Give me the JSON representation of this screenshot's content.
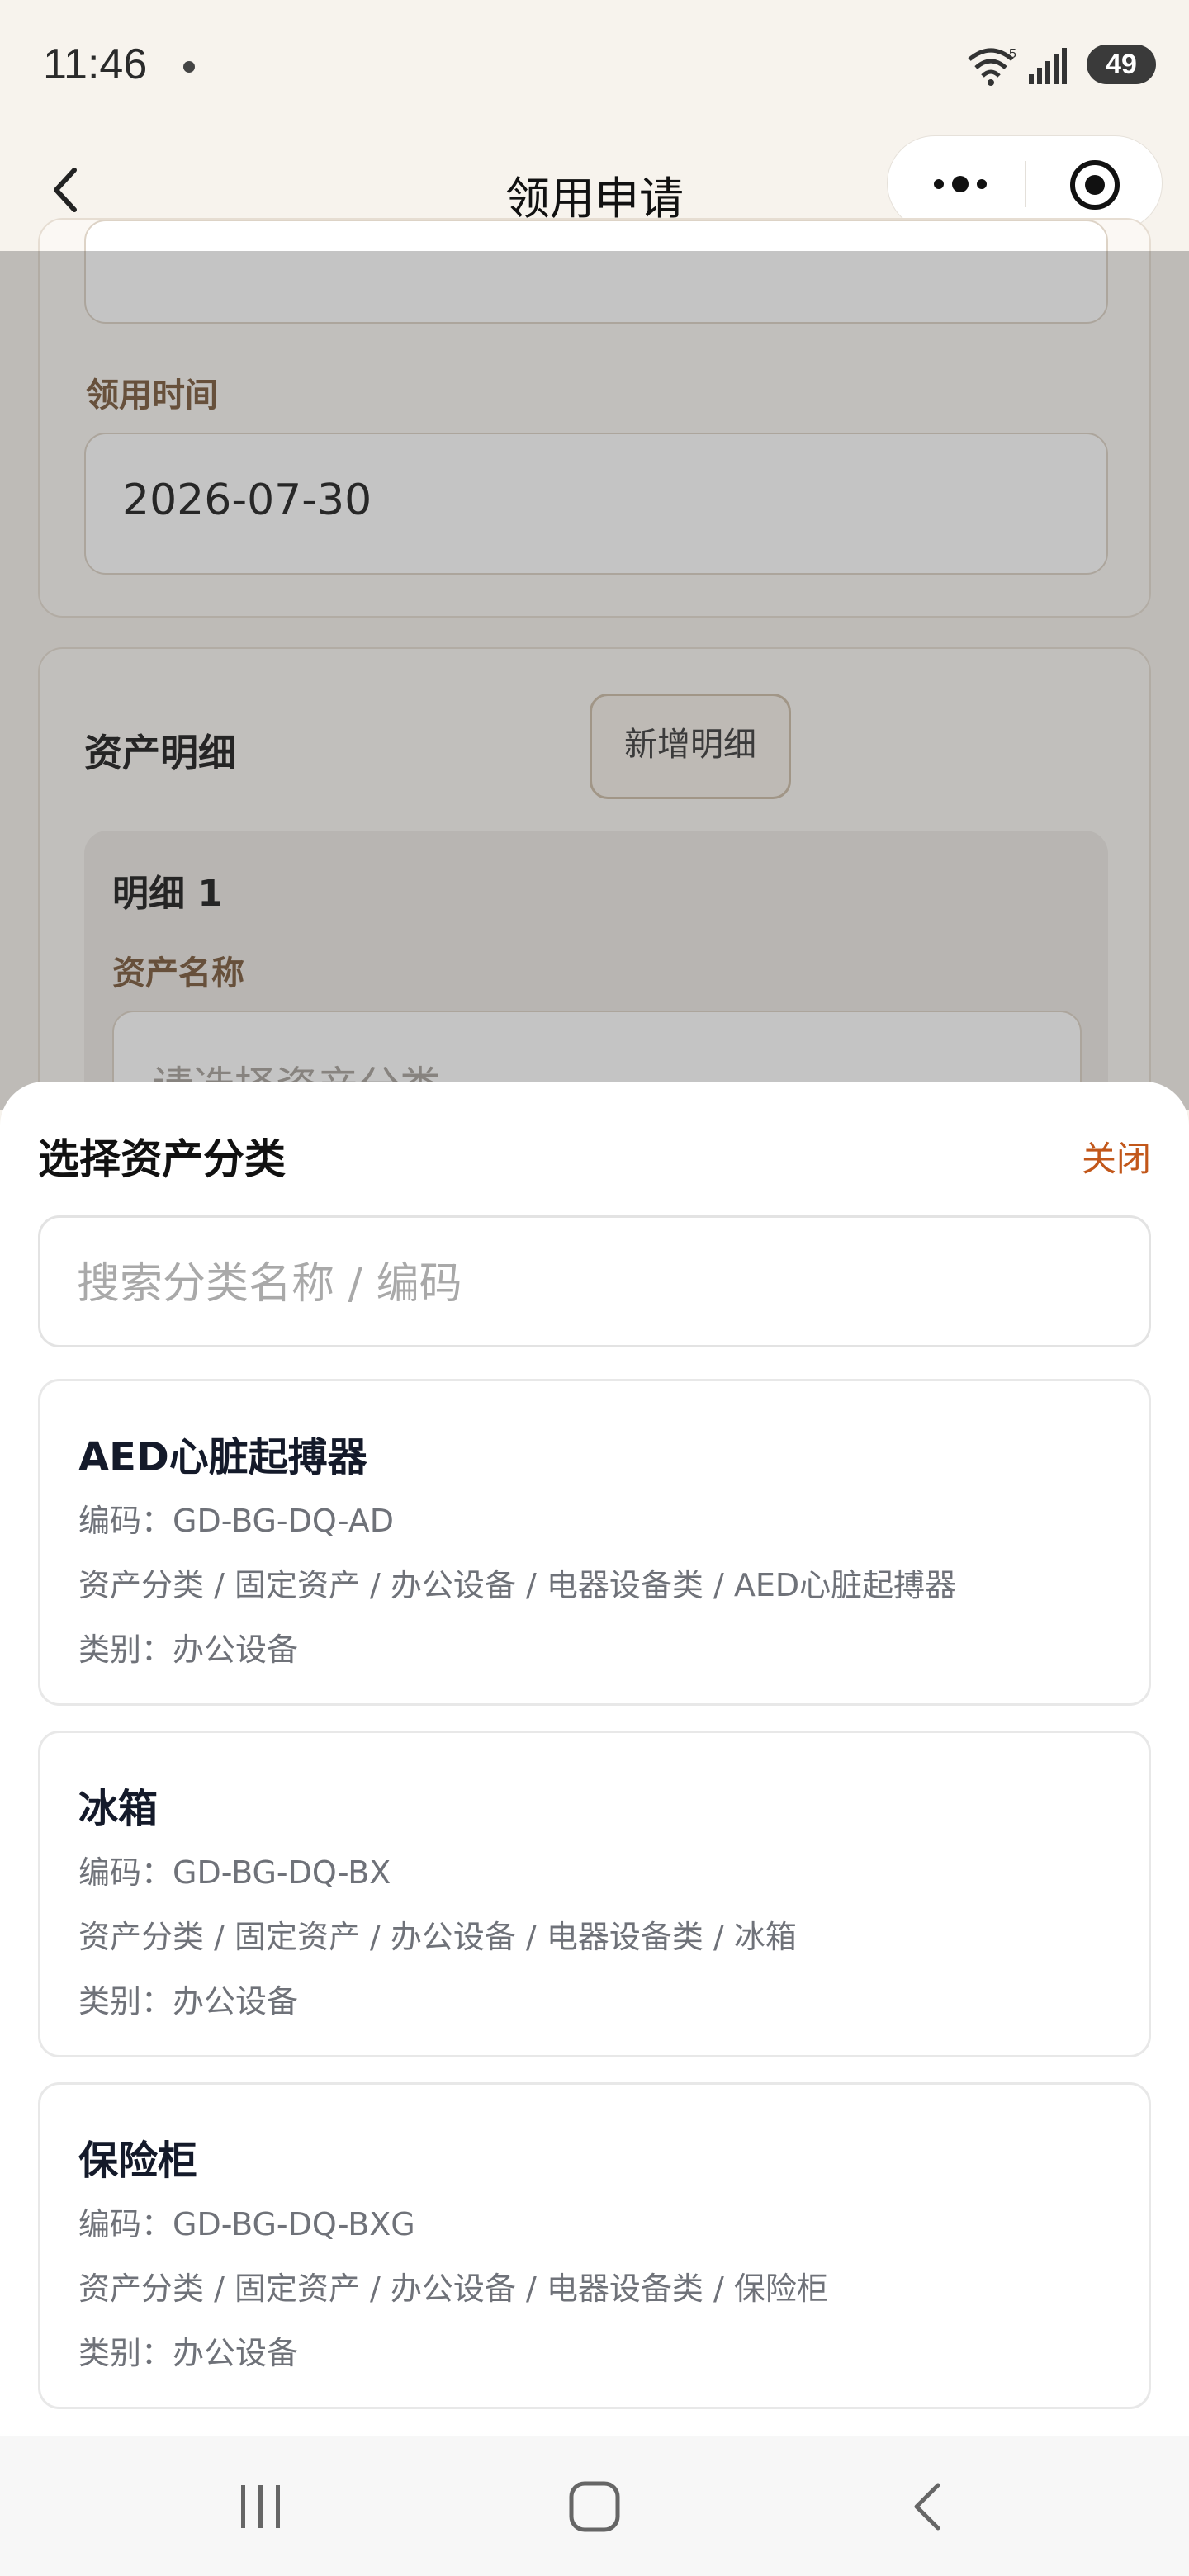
{
  "status_bar": {
    "time": "11:46",
    "battery": "49",
    "signal_badge": "5"
  },
  "nav": {
    "title": "领用申请",
    "icons": [
      "back-icon",
      "more-icon",
      "target-icon"
    ]
  },
  "form": {
    "receive_time_label": "领用时间",
    "receive_time_value": "2026-07-30",
    "asset_detail_title": "资产明细",
    "add_detail_label": "新增明细",
    "detail_1_title": "明细 1",
    "asset_name_label": "资产名称",
    "asset_name_placeholder": "请选择资产分类"
  },
  "sheet": {
    "title": "选择资产分类",
    "close_label": "关闭",
    "search_placeholder": "搜索分类名称 / 编码",
    "items": [
      {
        "name": "AED心脏起搏器",
        "code": "编码：GD-BG-DQ-AD",
        "path": "资产分类 / 固定资产 / 办公设备 / 电器设备类 / AED心脏起搏器",
        "category": "类别：办公设备"
      },
      {
        "name": "冰箱",
        "code": "编码：GD-BG-DQ-BX",
        "path": "资产分类 / 固定资产 / 办公设备 / 电器设备类 / 冰箱",
        "category": "类别：办公设备"
      },
      {
        "name": "保险柜",
        "code": "编码：GD-BG-DQ-BXG",
        "path": "资产分类 / 固定资产 / 办公设备 / 电器设备类 / 保险柜",
        "category": "类别：办公设备"
      }
    ]
  },
  "colors": {
    "accent": "#c2571a",
    "brown_label": "#7a5a3c",
    "page_bg": "#f6f2ec"
  }
}
